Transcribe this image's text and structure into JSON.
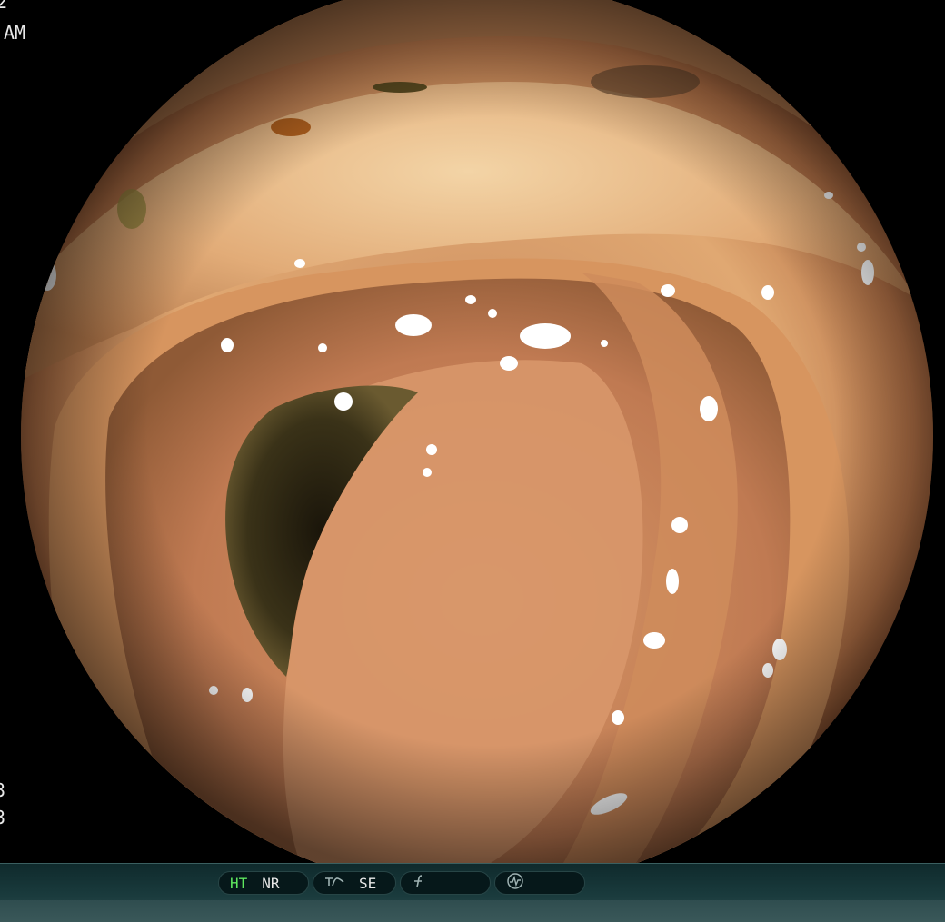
{
  "overlay": {
    "top_left_partial": "2",
    "top_left_time": "AM",
    "bottom_left_1": "3",
    "bottom_left_2": "3"
  },
  "status_bar": {
    "ht_label": "HT",
    "nr_label": "NR",
    "se_label": "SE",
    "ht_color": "#5ee65e",
    "text_color": "#e8e8e8"
  },
  "icons": {
    "enhance": "enhance-icon",
    "function": "function-icon",
    "waveform": "waveform-icon"
  },
  "colors": {
    "background": "#000000",
    "mucosa": "#d9a070",
    "lumen": "#2a2412"
  }
}
